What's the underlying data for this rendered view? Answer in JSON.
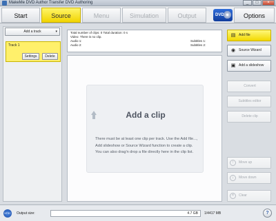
{
  "window": {
    "title": "MakeMe DVD Author Transfer DVD Authoring",
    "controls": [
      "_",
      "□",
      "×"
    ]
  },
  "steps": [
    {
      "label": "Start",
      "state": "enabled"
    },
    {
      "label": "Source",
      "state": "active"
    },
    {
      "label": "Menu",
      "state": "disabled"
    },
    {
      "label": "Simulation",
      "state": "disabled"
    },
    {
      "label": "Output",
      "state": "disabled"
    },
    {
      "label": "Options",
      "state": "enabled"
    }
  ],
  "dvd_badge": "DVD",
  "tracks": {
    "add_label": "Add a track",
    "caret": "▾",
    "items": [
      {
        "title": "Track 1",
        "settings_label": "Settings",
        "delete_label": "Delete"
      }
    ]
  },
  "info": {
    "clips_line": "Total number of clips: 0    Total duration: 0 s",
    "video_line": "Video:      There is no clip.",
    "audio1": "Audio 1:",
    "audio2": "Audio 2:",
    "subtitles1": "Subtitles 1:",
    "subtitles2": "Subtitles 2:"
  },
  "clip_hint": {
    "title": "Add a clip",
    "body": "There must be at least one clip per track. Use the Add file..., Add slideshow or Source Wizard function to create a  clip. You can also drag'n drop a file directly here in the clip list."
  },
  "side_buttons": {
    "add_file": "Add file",
    "source_wizard": "Source Wizard",
    "add_slideshow": "Add a slideshow",
    "convert": "Convert",
    "subtitle_editor": "Subtitles editor",
    "delete_clip": "Delete clip",
    "move_up": "Move up",
    "move_down": "Move down",
    "clear": "Clear"
  },
  "status": {
    "format": "NTSC",
    "output_size_label": "Output size:",
    "capacity": "4.7 GB",
    "used_fraction": 0.0,
    "remaining": "1/4417 MB",
    "help": "?"
  },
  "colors": {
    "active_step": "#f5dc00",
    "dvd_badge": "#1f55c5"
  }
}
